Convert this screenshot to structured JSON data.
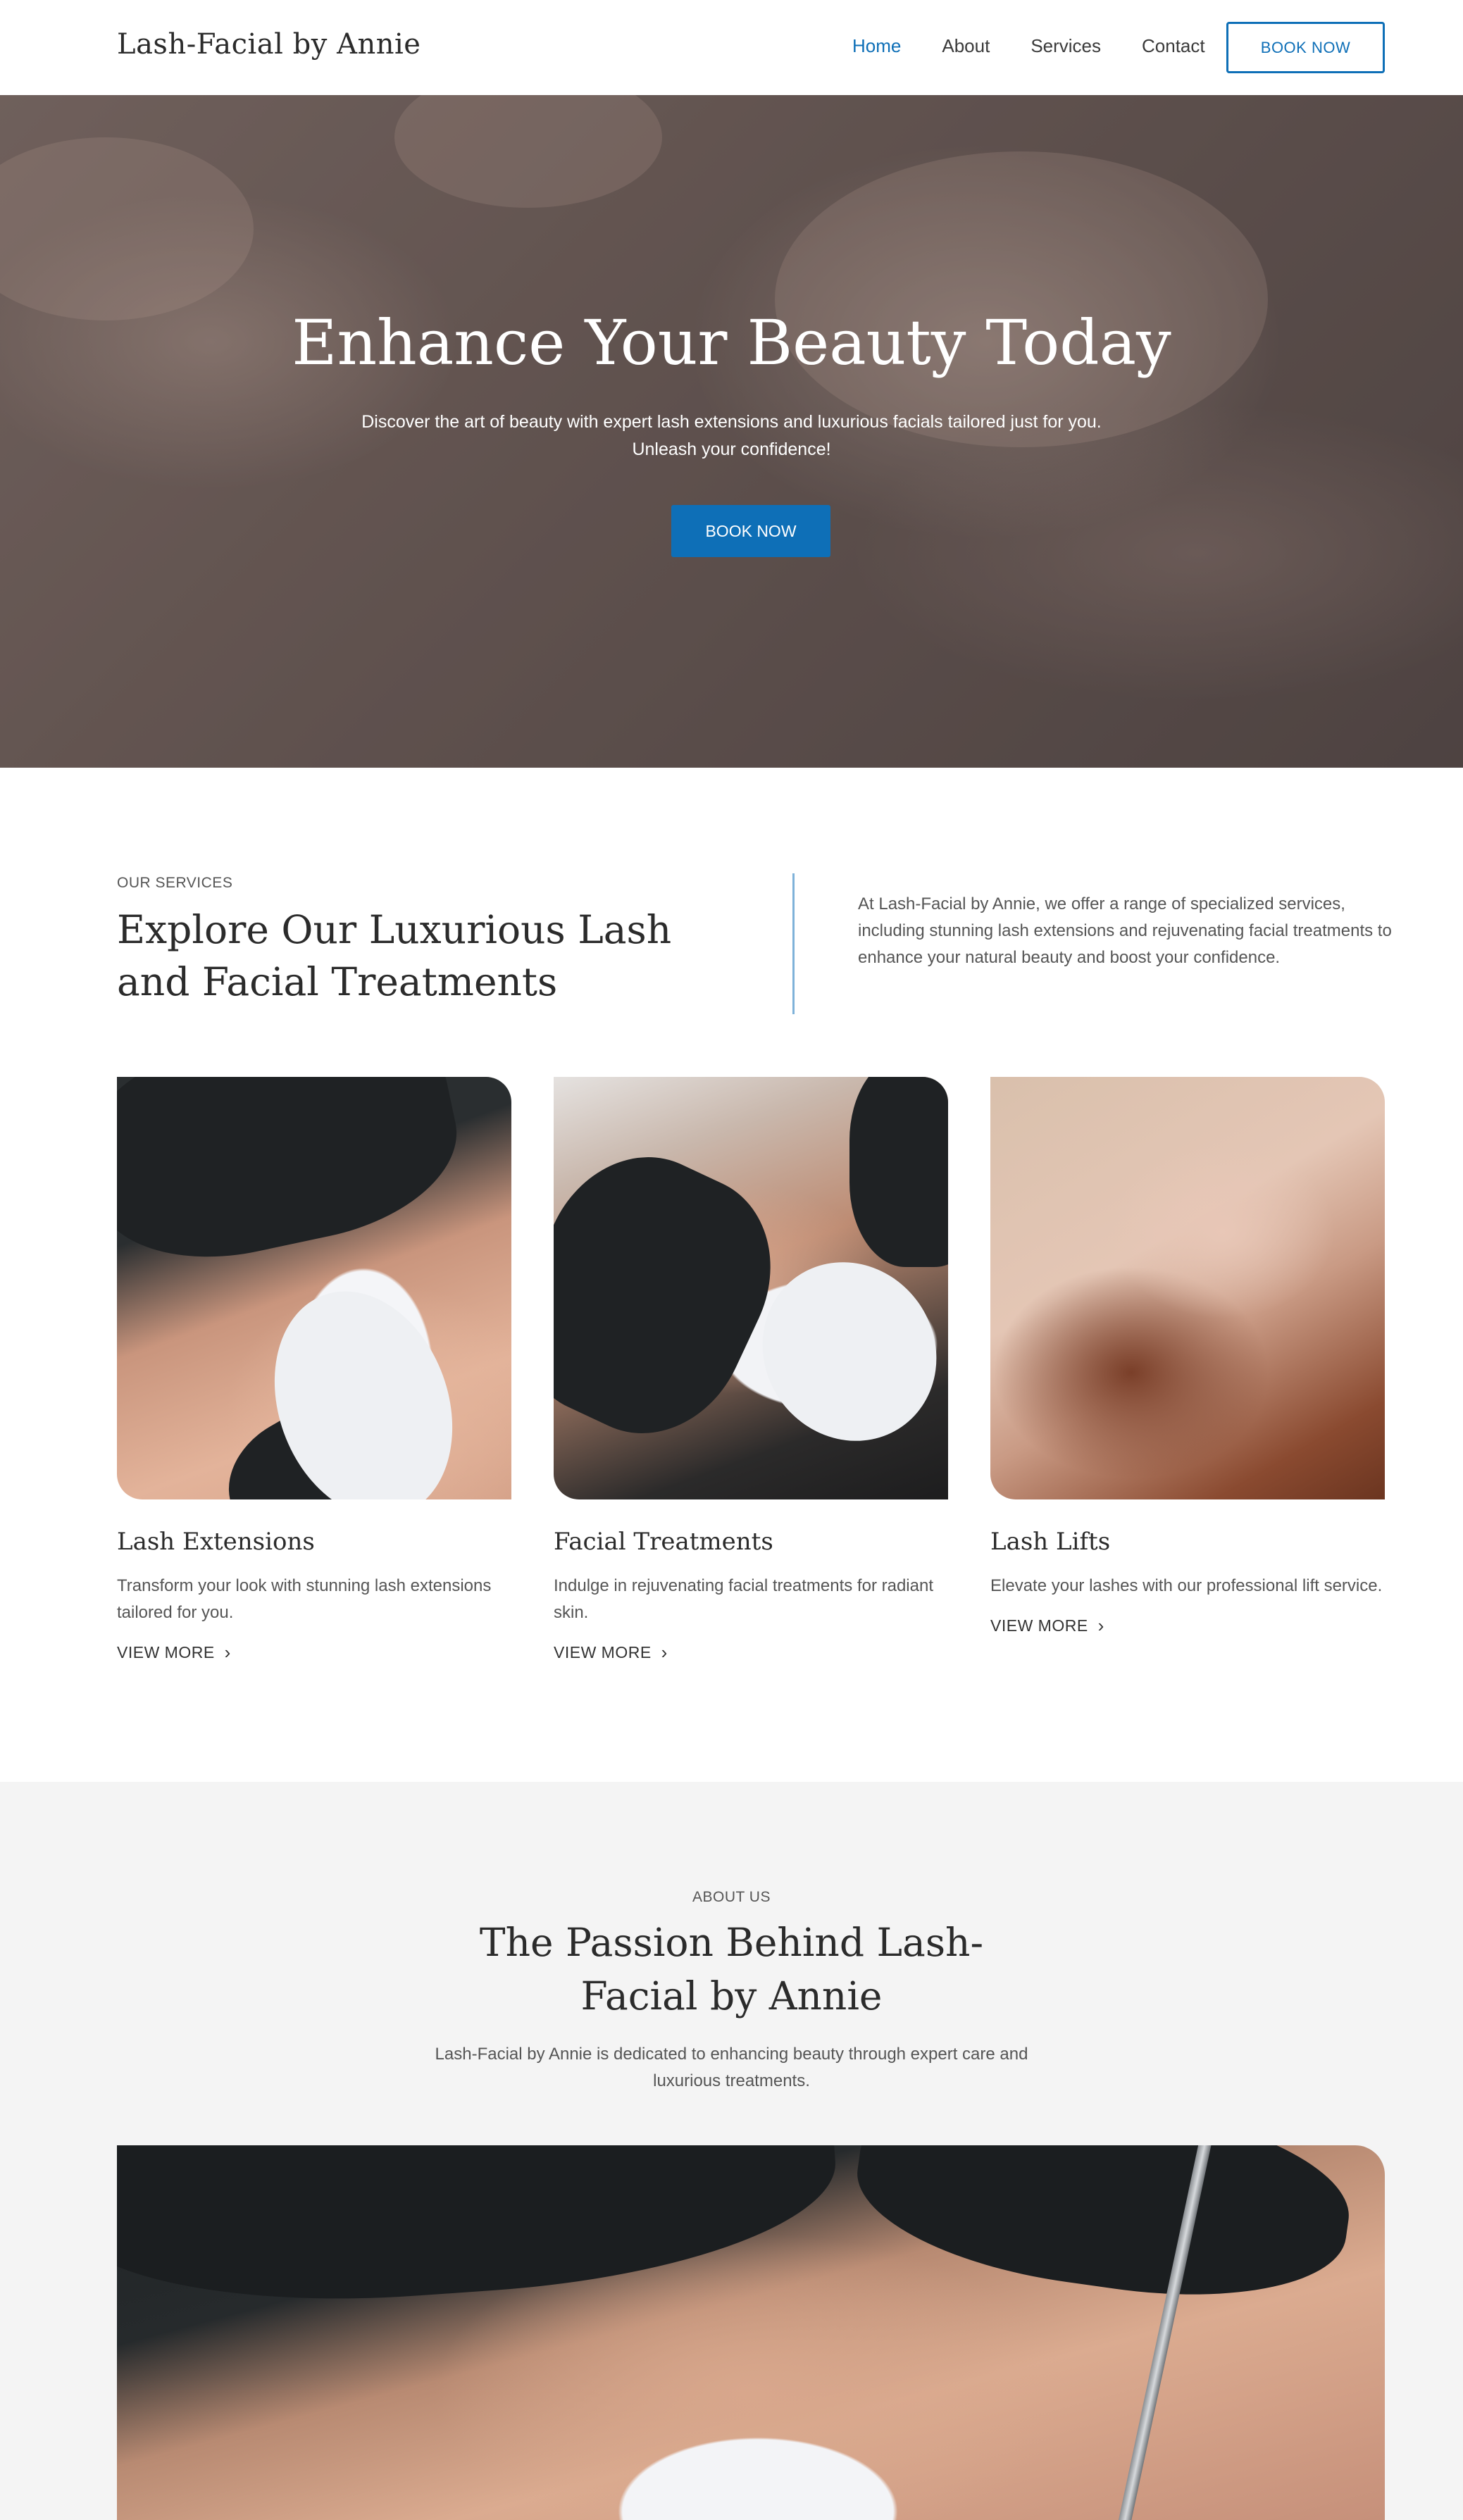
{
  "header": {
    "brand": "Lash-Facial by Annie",
    "nav": [
      "Home",
      "About",
      "Services",
      "Contact"
    ],
    "active_nav": "Home",
    "book_button": "BOOK NOW"
  },
  "hero": {
    "title": "Enhance Your Beauty Today",
    "subtitle": "Discover the art of beauty with expert lash extensions and luxurious facials tailored just for you. Unleash your confidence!",
    "button": "BOOK NOW"
  },
  "services": {
    "eyebrow": "OUR SERVICES",
    "heading": "Explore Our Luxurious Lash and Facial Treatments",
    "intro": "At Lash-Facial by Annie, we offer a range of specialized services, including stunning lash extensions and rejuvenating facial treatments to enhance your natural beauty and boost your confidence.",
    "cards": [
      {
        "title": "Lash Extensions",
        "description": "Transform your look with stunning lash extensions tailored for you.",
        "link": "VIEW MORE"
      },
      {
        "title": "Facial Treatments",
        "description": "Indulge in rejuvenating facial treatments for radiant skin.",
        "link": "VIEW MORE"
      },
      {
        "title": "Lash Lifts",
        "description": "Elevate your lashes with our professional lift service.",
        "link": "VIEW MORE"
      }
    ]
  },
  "about": {
    "eyebrow": "ABOUT US",
    "heading": "The Passion Behind Lash-Facial by Annie",
    "text": "Lash-Facial by Annie is dedicated to enhancing beauty through expert care and luxurious treatments."
  },
  "colors": {
    "accent": "#0e6fb7",
    "about_background": "#f4f4f4",
    "divider": "#7fb2d9"
  }
}
